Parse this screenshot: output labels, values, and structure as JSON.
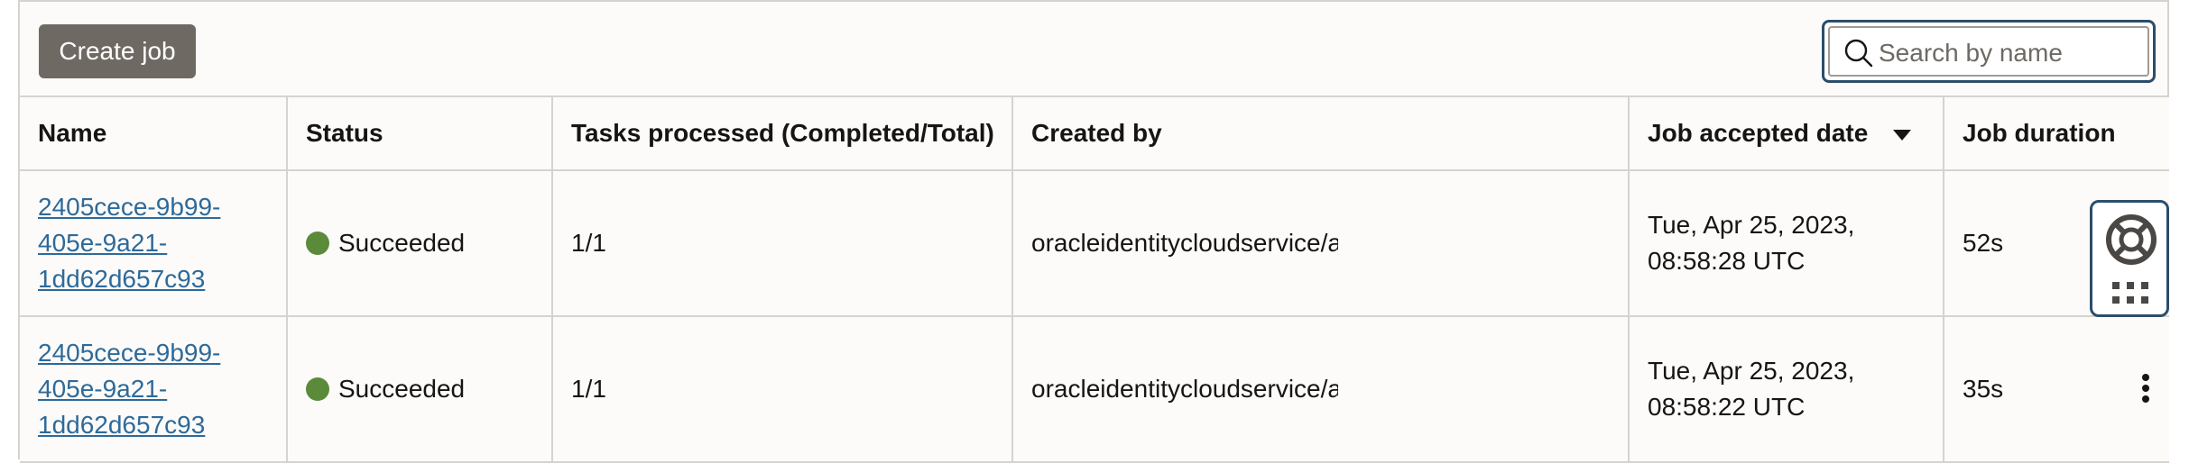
{
  "toolbar": {
    "create_label": "Create job",
    "search_placeholder": "Search by name"
  },
  "table": {
    "columns": [
      "Name",
      "Status",
      "Tasks processed (Completed/Total)",
      "Created by",
      "Job accepted date",
      "Job duration"
    ],
    "sort_column": "Job accepted date",
    "sort_direction": "descending",
    "rows": [
      {
        "name": "2405cece-9b99-405e-9a21-1dd62d657c93",
        "status": "Succeeded",
        "tasks": "1/1",
        "created_by": "oracleidentitycloudservice/a",
        "accepted_line1": "Tue, Apr 25, 2023,",
        "accepted_line2": "08:58:28 UTC",
        "duration": "52s"
      },
      {
        "name": "2405cece-9b99-405e-9a21-1dd62d657c93",
        "status": "Succeeded",
        "tasks": "1/1",
        "created_by": "oracleidentitycloudservice/a",
        "accepted_line1": "Tue, Apr 25, 2023,",
        "accepted_line2": "08:58:22 UTC",
        "duration": "35s"
      }
    ]
  },
  "colors": {
    "status_success": "#5b8a3a",
    "link": "#2e6a99",
    "primary_button": "#6f6964",
    "focus_ring": "#2b4e6a"
  },
  "icons": {
    "search": "search-icon",
    "help": "lifebuoy-icon",
    "apps": "grid-icon",
    "row_actions": "kebab-icon"
  }
}
